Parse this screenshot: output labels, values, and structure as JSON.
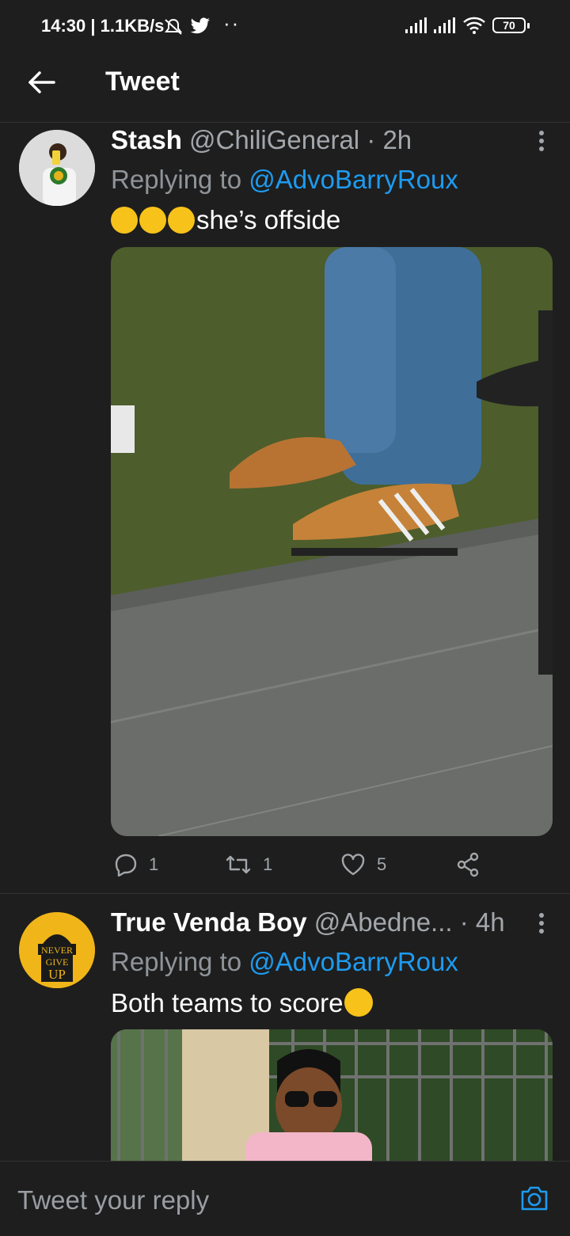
{
  "status_bar": {
    "time": "14:30 | 1.1KB/s",
    "battery": "70",
    "more": "··"
  },
  "header": {
    "title": "Tweet"
  },
  "tweets": [
    {
      "name": "Stash",
      "handle": "@ChiliGeneral · 2h",
      "replying_prefix": "Replying to ",
      "replying_handle": "@AdvoBarryRoux",
      "text": "she’s offside",
      "emoji": [
        "rofl-emoji",
        "rofl-emoji",
        "rofl-emoji"
      ],
      "actions": {
        "replies": "1",
        "retweets": "1",
        "likes": "5"
      }
    },
    {
      "name": "True Venda Boy",
      "handle": "@Abedne... · 4h",
      "replying_prefix": "Replying to ",
      "replying_handle": "@AdvoBarryRoux",
      "text": "Both teams to score",
      "emoji": [
        "smile-emoji"
      ],
      "avatar_text": [
        "NEVER",
        "GIVE",
        "UP"
      ]
    }
  ],
  "reply_bar": {
    "placeholder": "Tweet your reply"
  },
  "colors": {
    "background": "#1e1e1e",
    "accent": "#1d9bf0",
    "muted": "#8f9499"
  }
}
